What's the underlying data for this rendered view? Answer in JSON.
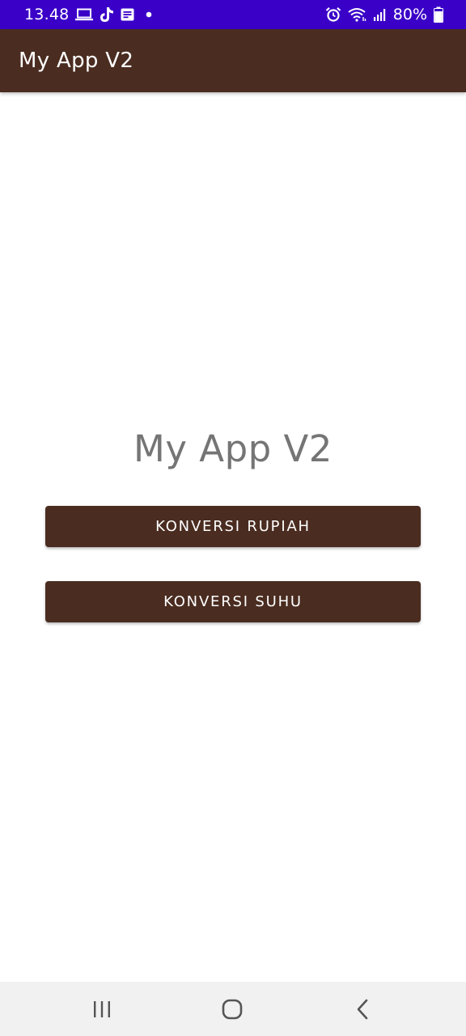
{
  "status_bar": {
    "time": "13.48",
    "battery_percent": "80%",
    "background_color": "#3a00c8",
    "left_icons": [
      "laptop-icon",
      "tiktok-icon",
      "notification-list-icon",
      "dot-icon"
    ],
    "right_icons": [
      "alarm-icon",
      "wifi-icon",
      "signal-icon",
      "battery-icon"
    ],
    "battery_level": 0.8
  },
  "app_bar": {
    "title": "My App V2",
    "background_color": "#4a2c20"
  },
  "main": {
    "title": "My App V2",
    "buttons": [
      {
        "label": "KONVERSI RUPIAH"
      },
      {
        "label": "KONVERSI SUHU"
      }
    ],
    "button_color": "#4a2c20"
  },
  "nav_bar": {
    "buttons": [
      "recent-apps-icon",
      "home-icon",
      "back-icon"
    ]
  }
}
